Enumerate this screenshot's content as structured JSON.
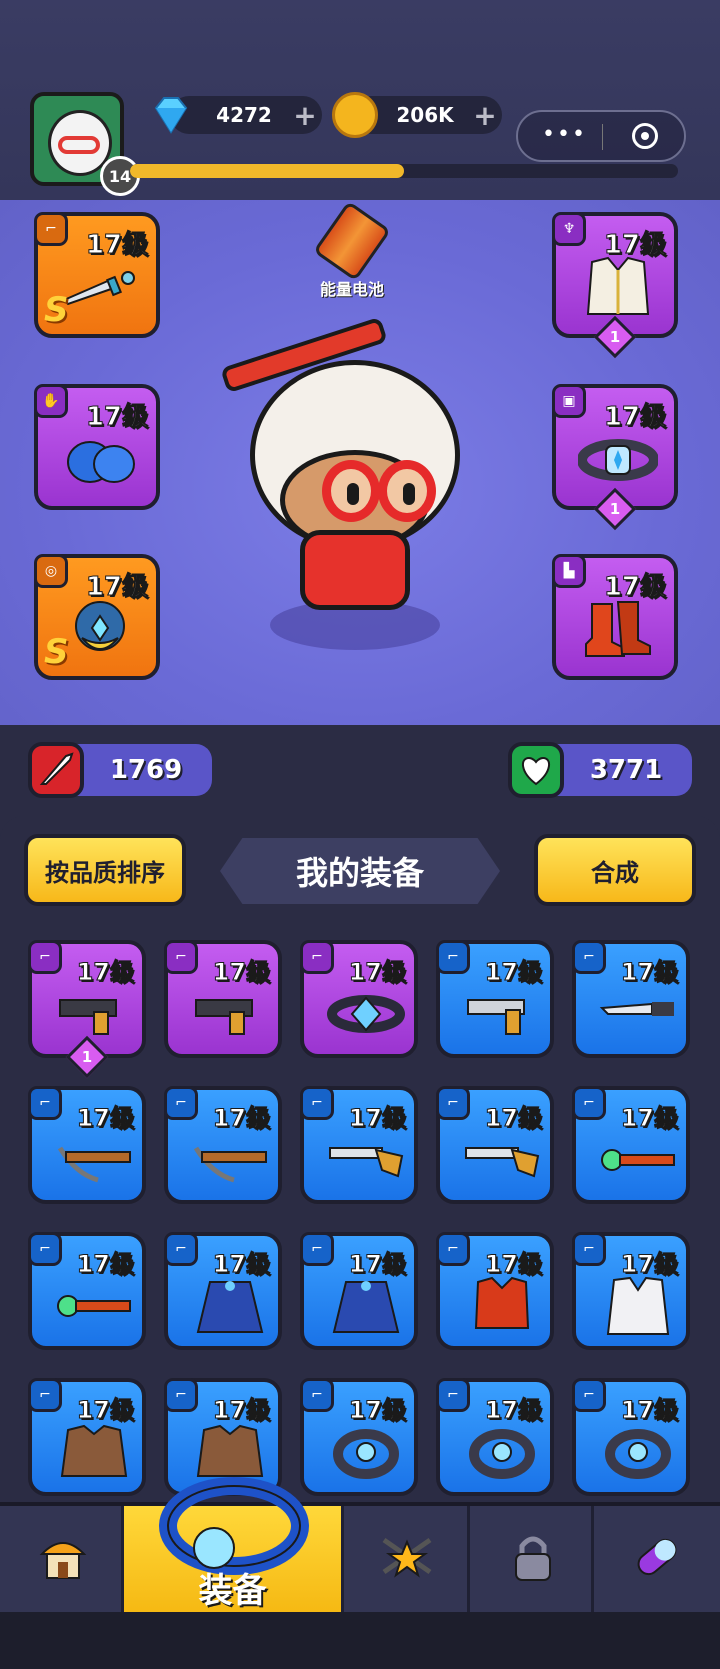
{
  "header": {
    "player_level": "14",
    "xp_fraction": 0.5,
    "gems": "4272",
    "coins": "206K",
    "plus": "+",
    "menu_dots": "•••"
  },
  "hero": {
    "battery_label": "能量电池",
    "left_slots": [
      {
        "level": "17级",
        "grade": "S",
        "rarity": "orange",
        "icon": "gun-type-icon",
        "item": "dagger"
      },
      {
        "level": "17级",
        "rarity": "purple",
        "icon": "glove-type-icon",
        "item": "gloves"
      },
      {
        "level": "17级",
        "grade": "S",
        "rarity": "orange",
        "icon": "ring-type-icon",
        "item": "necklace"
      }
    ],
    "right_slots": [
      {
        "level": "17级",
        "star": "1",
        "rarity": "purple",
        "icon": "armor-type-icon",
        "item": "vest"
      },
      {
        "level": "17级",
        "star": "1",
        "rarity": "purple",
        "icon": "belt-type-icon",
        "item": "belt"
      },
      {
        "level": "17级",
        "rarity": "purple",
        "icon": "boot-type-icon",
        "item": "boots"
      }
    ],
    "attack": "1769",
    "health": "3771"
  },
  "equipment_panel": {
    "sort_button": "按品质排序",
    "title": "我的装备",
    "merge_button": "合成",
    "items": [
      {
        "level": "17级",
        "rarity": "purple",
        "star": "1",
        "item": "pistol"
      },
      {
        "level": "17级",
        "rarity": "purple",
        "item": "pistol"
      },
      {
        "level": "17级",
        "rarity": "purple",
        "item": "belt"
      },
      {
        "level": "17级",
        "rarity": "blue",
        "item": "revolver"
      },
      {
        "level": "17级",
        "rarity": "blue",
        "item": "knife"
      },
      {
        "level": "17级",
        "rarity": "blue",
        "item": "crossbow"
      },
      {
        "level": "17级",
        "rarity": "blue",
        "item": "crossbow"
      },
      {
        "level": "17级",
        "rarity": "blue",
        "item": "shotgun"
      },
      {
        "level": "17级",
        "rarity": "blue",
        "item": "shotgun"
      },
      {
        "level": "17级",
        "rarity": "blue",
        "item": "staff"
      },
      {
        "level": "17级",
        "rarity": "blue",
        "item": "staff"
      },
      {
        "level": "17级",
        "rarity": "blue",
        "item": "cape"
      },
      {
        "level": "17级",
        "rarity": "blue",
        "item": "cape"
      },
      {
        "level": "17级",
        "rarity": "blue",
        "item": "vest"
      },
      {
        "level": "17级",
        "rarity": "blue",
        "item": "robe"
      },
      {
        "level": "17级",
        "rarity": "blue",
        "item": "jacket"
      },
      {
        "level": "17级",
        "rarity": "blue",
        "item": "jacket"
      },
      {
        "level": "17级",
        "rarity": "blue",
        "item": "ring"
      },
      {
        "level": "17级",
        "rarity": "blue",
        "item": "ring"
      },
      {
        "level": "17级",
        "rarity": "blue",
        "item": "ring"
      }
    ]
  },
  "navbar": {
    "tabs": [
      {
        "name": "shop-icon",
        "label": ""
      },
      {
        "name": "equipment-ring-icon",
        "label": "装备"
      },
      {
        "name": "star-weapons-icon",
        "label": ""
      },
      {
        "name": "lock-icon",
        "label": ""
      },
      {
        "name": "capsule-icon",
        "label": ""
      }
    ]
  },
  "colors": {
    "orange": "#f07410",
    "purple": "#9a34d0",
    "blue": "#1a73e8",
    "accent_yellow": "#f7b81a"
  }
}
